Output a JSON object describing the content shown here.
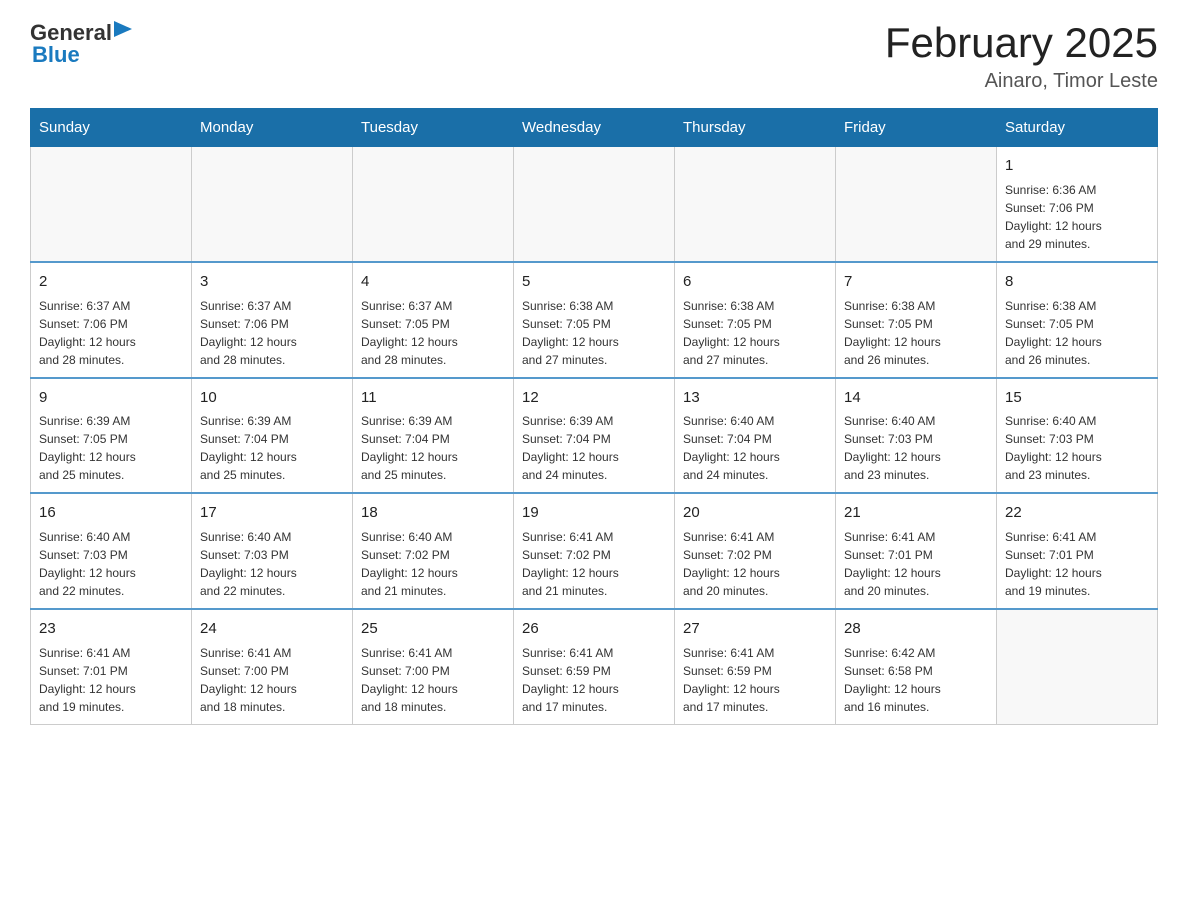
{
  "logo": {
    "general": "General",
    "blue": "Blue"
  },
  "title": "February 2025",
  "subtitle": "Ainaro, Timor Leste",
  "weekdays": [
    "Sunday",
    "Monday",
    "Tuesday",
    "Wednesday",
    "Thursday",
    "Friday",
    "Saturday"
  ],
  "weeks": [
    [
      {
        "day": "",
        "info": ""
      },
      {
        "day": "",
        "info": ""
      },
      {
        "day": "",
        "info": ""
      },
      {
        "day": "",
        "info": ""
      },
      {
        "day": "",
        "info": ""
      },
      {
        "day": "",
        "info": ""
      },
      {
        "day": "1",
        "info": "Sunrise: 6:36 AM\nSunset: 7:06 PM\nDaylight: 12 hours\nand 29 minutes."
      }
    ],
    [
      {
        "day": "2",
        "info": "Sunrise: 6:37 AM\nSunset: 7:06 PM\nDaylight: 12 hours\nand 28 minutes."
      },
      {
        "day": "3",
        "info": "Sunrise: 6:37 AM\nSunset: 7:06 PM\nDaylight: 12 hours\nand 28 minutes."
      },
      {
        "day": "4",
        "info": "Sunrise: 6:37 AM\nSunset: 7:05 PM\nDaylight: 12 hours\nand 28 minutes."
      },
      {
        "day": "5",
        "info": "Sunrise: 6:38 AM\nSunset: 7:05 PM\nDaylight: 12 hours\nand 27 minutes."
      },
      {
        "day": "6",
        "info": "Sunrise: 6:38 AM\nSunset: 7:05 PM\nDaylight: 12 hours\nand 27 minutes."
      },
      {
        "day": "7",
        "info": "Sunrise: 6:38 AM\nSunset: 7:05 PM\nDaylight: 12 hours\nand 26 minutes."
      },
      {
        "day": "8",
        "info": "Sunrise: 6:38 AM\nSunset: 7:05 PM\nDaylight: 12 hours\nand 26 minutes."
      }
    ],
    [
      {
        "day": "9",
        "info": "Sunrise: 6:39 AM\nSunset: 7:05 PM\nDaylight: 12 hours\nand 25 minutes."
      },
      {
        "day": "10",
        "info": "Sunrise: 6:39 AM\nSunset: 7:04 PM\nDaylight: 12 hours\nand 25 minutes."
      },
      {
        "day": "11",
        "info": "Sunrise: 6:39 AM\nSunset: 7:04 PM\nDaylight: 12 hours\nand 25 minutes."
      },
      {
        "day": "12",
        "info": "Sunrise: 6:39 AM\nSunset: 7:04 PM\nDaylight: 12 hours\nand 24 minutes."
      },
      {
        "day": "13",
        "info": "Sunrise: 6:40 AM\nSunset: 7:04 PM\nDaylight: 12 hours\nand 24 minutes."
      },
      {
        "day": "14",
        "info": "Sunrise: 6:40 AM\nSunset: 7:03 PM\nDaylight: 12 hours\nand 23 minutes."
      },
      {
        "day": "15",
        "info": "Sunrise: 6:40 AM\nSunset: 7:03 PM\nDaylight: 12 hours\nand 23 minutes."
      }
    ],
    [
      {
        "day": "16",
        "info": "Sunrise: 6:40 AM\nSunset: 7:03 PM\nDaylight: 12 hours\nand 22 minutes."
      },
      {
        "day": "17",
        "info": "Sunrise: 6:40 AM\nSunset: 7:03 PM\nDaylight: 12 hours\nand 22 minutes."
      },
      {
        "day": "18",
        "info": "Sunrise: 6:40 AM\nSunset: 7:02 PM\nDaylight: 12 hours\nand 21 minutes."
      },
      {
        "day": "19",
        "info": "Sunrise: 6:41 AM\nSunset: 7:02 PM\nDaylight: 12 hours\nand 21 minutes."
      },
      {
        "day": "20",
        "info": "Sunrise: 6:41 AM\nSunset: 7:02 PM\nDaylight: 12 hours\nand 20 minutes."
      },
      {
        "day": "21",
        "info": "Sunrise: 6:41 AM\nSunset: 7:01 PM\nDaylight: 12 hours\nand 20 minutes."
      },
      {
        "day": "22",
        "info": "Sunrise: 6:41 AM\nSunset: 7:01 PM\nDaylight: 12 hours\nand 19 minutes."
      }
    ],
    [
      {
        "day": "23",
        "info": "Sunrise: 6:41 AM\nSunset: 7:01 PM\nDaylight: 12 hours\nand 19 minutes."
      },
      {
        "day": "24",
        "info": "Sunrise: 6:41 AM\nSunset: 7:00 PM\nDaylight: 12 hours\nand 18 minutes."
      },
      {
        "day": "25",
        "info": "Sunrise: 6:41 AM\nSunset: 7:00 PM\nDaylight: 12 hours\nand 18 minutes."
      },
      {
        "day": "26",
        "info": "Sunrise: 6:41 AM\nSunset: 6:59 PM\nDaylight: 12 hours\nand 17 minutes."
      },
      {
        "day": "27",
        "info": "Sunrise: 6:41 AM\nSunset: 6:59 PM\nDaylight: 12 hours\nand 17 minutes."
      },
      {
        "day": "28",
        "info": "Sunrise: 6:42 AM\nSunset: 6:58 PM\nDaylight: 12 hours\nand 16 minutes."
      },
      {
        "day": "",
        "info": ""
      }
    ]
  ]
}
